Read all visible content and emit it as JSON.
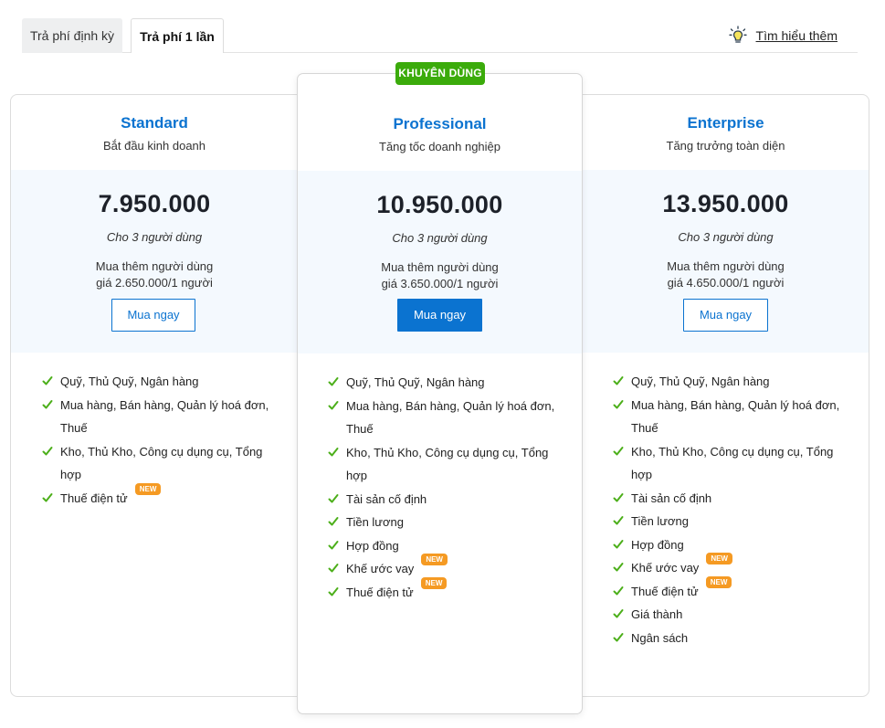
{
  "tabs": [
    {
      "label": "Trả phí định kỳ",
      "active": false
    },
    {
      "label": "Trả phí 1 lần",
      "active": true
    }
  ],
  "learn_more": {
    "label": "Tìm hiểu thêm",
    "icon": "lightbulb-icon"
  },
  "recommended_badge": "KHUYÊN DÙNG",
  "new_badge": "NEW",
  "colors": {
    "accent": "#0b73d0",
    "badge_green": "#3bab0b",
    "new_orange": "#f59a23",
    "check_green": "#4caf1a"
  },
  "plans": [
    {
      "name": "Standard",
      "tagline": "Bắt đầu kinh doanh",
      "price": "7.950.000",
      "users": "Cho 3 người dùng",
      "extra_line1": "Mua thêm người dùng",
      "extra_line2": "giá 2.650.000/1 người",
      "button": "Mua ngay",
      "features": [
        {
          "lines": [
            "Quỹ, Thủ Quỹ, Ngân hàng"
          ]
        },
        {
          "lines": [
            "Mua hàng, Bán hàng, Quản lý hoá đơn,",
            "Thuế"
          ]
        },
        {
          "lines": [
            "Kho, Thủ Kho, Công cụ dụng cụ, Tổng",
            "hợp"
          ]
        },
        {
          "lines": [
            "Thuế điện tử"
          ],
          "new": true
        }
      ]
    },
    {
      "name": "Professional",
      "tagline": "Tăng tốc doanh nghiệp",
      "price": "10.950.000",
      "users": "Cho 3 người dùng",
      "extra_line1": "Mua thêm người dùng",
      "extra_line2": "giá 3.650.000/1 người",
      "button": "Mua ngay",
      "recommended": true,
      "features": [
        {
          "lines": [
            "Quỹ, Thủ Quỹ, Ngân hàng"
          ]
        },
        {
          "lines": [
            "Mua hàng, Bán hàng, Quản lý hoá đơn,",
            "Thuế"
          ]
        },
        {
          "lines": [
            "Kho, Thủ Kho, Công cụ dụng cụ, Tổng",
            "hợp"
          ]
        },
        {
          "lines": [
            "Tài sản cố định"
          ]
        },
        {
          "lines": [
            "Tiền lương"
          ]
        },
        {
          "lines": [
            "Hợp đồng"
          ]
        },
        {
          "lines": [
            "Khế ước vay"
          ],
          "new": true
        },
        {
          "lines": [
            "Thuế điện tử"
          ],
          "new": true
        }
      ]
    },
    {
      "name": "Enterprise",
      "tagline": "Tăng trưởng toàn diện",
      "price": "13.950.000",
      "users": "Cho 3 người dùng",
      "extra_line1": "Mua thêm người dùng",
      "extra_line2": "giá 4.650.000/1 người",
      "button": "Mua ngay",
      "features": [
        {
          "lines": [
            "Quỹ, Thủ Quỹ, Ngân hàng"
          ]
        },
        {
          "lines": [
            "Mua hàng, Bán hàng, Quản lý hoá đơn,",
            "Thuế"
          ]
        },
        {
          "lines": [
            "Kho, Thủ Kho, Công cụ dụng cụ, Tổng",
            "hợp"
          ]
        },
        {
          "lines": [
            "Tài sản cố định"
          ]
        },
        {
          "lines": [
            "Tiền lương"
          ]
        },
        {
          "lines": [
            "Hợp đồng"
          ]
        },
        {
          "lines": [
            "Khế ước vay"
          ],
          "new": true
        },
        {
          "lines": [
            "Thuế điện tử"
          ],
          "new": true
        },
        {
          "lines": [
            "Giá thành"
          ]
        },
        {
          "lines": [
            "Ngân sách"
          ]
        }
      ]
    }
  ]
}
